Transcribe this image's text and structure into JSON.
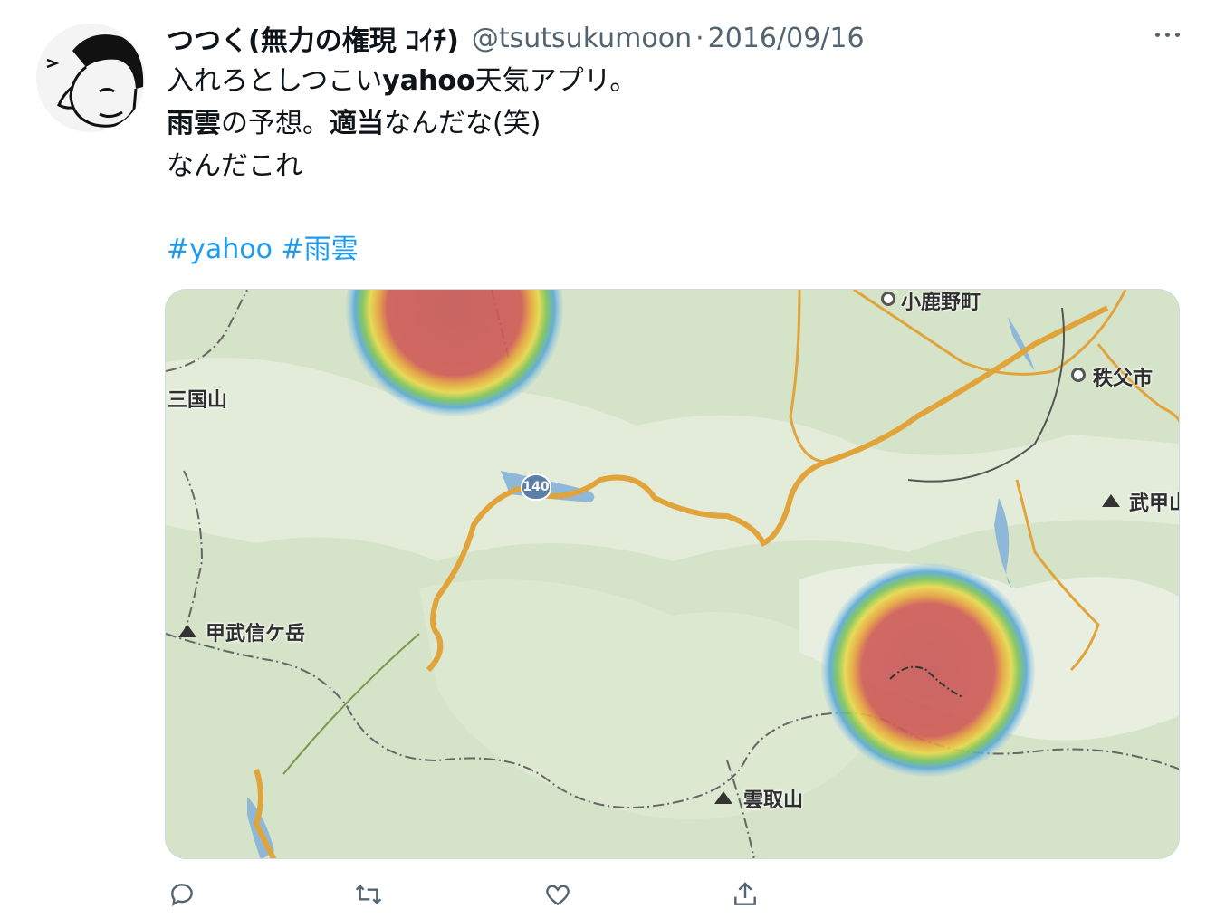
{
  "tweet": {
    "display_name": "つつく(無力の権現 ｺｲﾁ)",
    "handle": "@tsutsukumoon",
    "separator": "·",
    "date": "2016/09/16",
    "line1_a": "入れろとしつこい",
    "line1_b": "yahoo",
    "line1_c": "天気アプリ。",
    "line2_a": "雨雲",
    "line2_b": "の予想。",
    "line2_c": "適当",
    "line2_d": "なんだな(笑)",
    "line3": "なんだこれ",
    "hashtag1": "#yahoo",
    "hashtag2": "#雨雲"
  },
  "map": {
    "labels": {
      "kohano": "小鹿野町",
      "chichibu": "秩父市",
      "mikuniyama": "三国山",
      "bukou": "武甲山",
      "kobushi": "甲武信ケ岳",
      "kumotori": "雲取山",
      "route": "140"
    }
  },
  "icons": {
    "reply": "reply-icon",
    "retweet": "retweet-icon",
    "like": "heart-icon",
    "share": "share-icon",
    "more": "more-icon"
  },
  "colors": {
    "hashtag": "#1d9bf0",
    "road": "#e0a43a",
    "rain_red": "#c85a5a",
    "map_bg": "#d5e3c8"
  }
}
